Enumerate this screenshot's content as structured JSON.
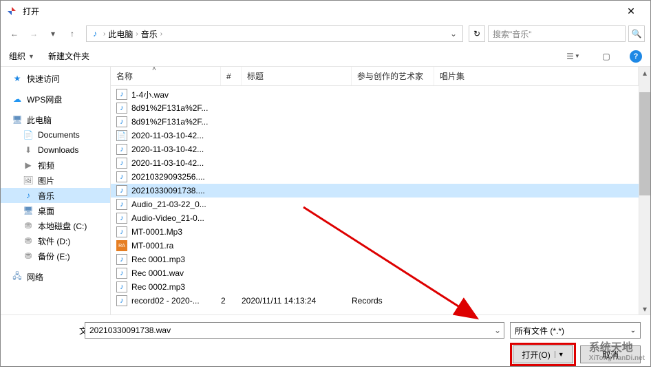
{
  "window": {
    "title": "打开",
    "close": "✕"
  },
  "nav": {
    "back": "←",
    "forward": "→",
    "dropdown": "▾",
    "up": "↑",
    "refresh": "↻"
  },
  "breadcrumb": {
    "parts": [
      "此电脑",
      "音乐"
    ],
    "sep": "›"
  },
  "search": {
    "placeholder": "搜索\"音乐\"",
    "icon": "🔍"
  },
  "toolbar": {
    "organize": "组织",
    "new_folder": "新建文件夹",
    "view": "☰",
    "preview": "▢",
    "help": "?"
  },
  "sidebar": {
    "items": [
      {
        "icon": "★",
        "color": "#1e88e5",
        "label": "快速访问",
        "indent": false
      },
      {
        "icon": "☁",
        "color": "#2196f3",
        "label": "WPS网盘",
        "indent": false
      },
      {
        "icon": "🖥",
        "color": "#6090c0",
        "label": "此电脑",
        "indent": false
      },
      {
        "icon": "📄",
        "color": "#888",
        "label": "Documents",
        "indent": true
      },
      {
        "icon": "⬇",
        "color": "#888",
        "label": "Downloads",
        "indent": true
      },
      {
        "icon": "▶",
        "color": "#888",
        "label": "视频",
        "indent": true
      },
      {
        "icon": "🖼",
        "color": "#888",
        "label": "图片",
        "indent": true
      },
      {
        "icon": "♪",
        "color": "#1e88e5",
        "label": "音乐",
        "indent": true,
        "selected": true
      },
      {
        "icon": "🖥",
        "color": "#6090c0",
        "label": "桌面",
        "indent": true
      },
      {
        "icon": "⛃",
        "color": "#888",
        "label": "本地磁盘 (C:)",
        "indent": true
      },
      {
        "icon": "⛃",
        "color": "#888",
        "label": "软件 (D:)",
        "indent": true
      },
      {
        "icon": "⛃",
        "color": "#888",
        "label": "备份 (E:)",
        "indent": true
      },
      {
        "icon": "🖧",
        "color": "#6090c0",
        "label": "网络",
        "indent": false
      }
    ]
  },
  "columns": {
    "name": "名称",
    "num": "#",
    "title": "标题",
    "artist": "参与创作的艺术家",
    "album": "唱片集"
  },
  "files": [
    {
      "icon": "♪",
      "name": "1-4小.wav",
      "num": "",
      "title": "",
      "artist": ""
    },
    {
      "icon": "♪",
      "name": "8d91%2F131a%2F...",
      "num": "",
      "title": "",
      "artist": ""
    },
    {
      "icon": "♪",
      "name": "8d91%2F131a%2F...",
      "num": "",
      "title": "",
      "artist": ""
    },
    {
      "icon": "📄",
      "name": "2020-11-03-10-42...",
      "num": "",
      "title": "",
      "artist": ""
    },
    {
      "icon": "♪",
      "name": "2020-11-03-10-42...",
      "num": "",
      "title": "",
      "artist": ""
    },
    {
      "icon": "♪",
      "name": "2020-11-03-10-42...",
      "num": "",
      "title": "",
      "artist": ""
    },
    {
      "icon": "♪",
      "name": "20210329093256....",
      "num": "",
      "title": "",
      "artist": ""
    },
    {
      "icon": "♪",
      "name": "20210330091738....",
      "num": "",
      "title": "",
      "artist": "",
      "selected": true
    },
    {
      "icon": "♪",
      "name": "Audio_21-03-22_0...",
      "num": "",
      "title": "",
      "artist": ""
    },
    {
      "icon": "♪",
      "name": "Audio-Video_21-0...",
      "num": "",
      "title": "",
      "artist": ""
    },
    {
      "icon": "♪",
      "name": "MT-0001.Mp3",
      "num": "",
      "title": "",
      "artist": ""
    },
    {
      "icon": "RA",
      "name": "MT-0001.ra",
      "num": "",
      "title": "",
      "artist": "",
      "iconcolor": "#e67e22"
    },
    {
      "icon": "♪",
      "name": "Rec 0001.mp3",
      "num": "",
      "title": "",
      "artist": ""
    },
    {
      "icon": "♪",
      "name": "Rec 0001.wav",
      "num": "",
      "title": "",
      "artist": ""
    },
    {
      "icon": "♪",
      "name": "Rec 0002.mp3",
      "num": "",
      "title": "",
      "artist": ""
    },
    {
      "icon": "♪",
      "name": "record02 - 2020-...",
      "num": "2",
      "title": "2020/11/11 14:13:24",
      "artist": "Records"
    }
  ],
  "footer": {
    "filename_label": "文件名(N):",
    "filename_value": "20210330091738.wav",
    "filetype": "所有文件 (*.*)",
    "open_btn": "打开(O)",
    "cancel_btn": "取消"
  },
  "watermark": {
    "cn": "系统天地",
    "url": "XiTongTianDi.net"
  }
}
